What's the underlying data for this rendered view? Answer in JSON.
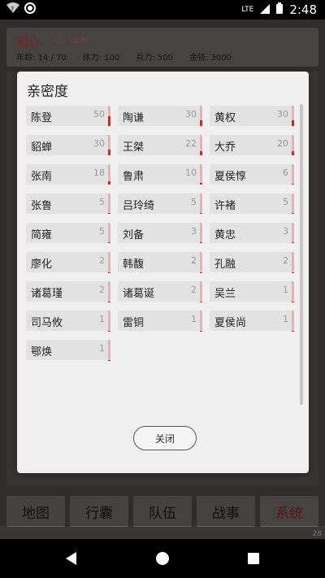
{
  "status_bar": {
    "time": "2:48",
    "network": "LTE"
  },
  "profile": {
    "name": "初心",
    "tags": "[无] [弈虎]",
    "age_label": "年龄: 14 / 70",
    "stamina_label": "体力: 100",
    "troops_label": "兵力: 500",
    "money_label": "金钱: 3000"
  },
  "dialog": {
    "title": "亲密度",
    "close_label": "关闭",
    "items": [
      {
        "name": "陈登",
        "value": 50
      },
      {
        "name": "陶谦",
        "value": 30
      },
      {
        "name": "黄权",
        "value": 30
      },
      {
        "name": "貂蝉",
        "value": 30
      },
      {
        "name": "王桀",
        "value": 22
      },
      {
        "name": "大乔",
        "value": 20
      },
      {
        "name": "张南",
        "value": 18
      },
      {
        "name": "鲁肃",
        "value": 10
      },
      {
        "name": "夏侯惇",
        "value": 6
      },
      {
        "name": "张鲁",
        "value": 5
      },
      {
        "name": "吕玲绮",
        "value": 5
      },
      {
        "name": "许褚",
        "value": 5
      },
      {
        "name": "简雍",
        "value": 5
      },
      {
        "name": "刘备",
        "value": 3
      },
      {
        "name": "黄忠",
        "value": 3
      },
      {
        "name": "廖化",
        "value": 2
      },
      {
        "name": "韩馥",
        "value": 2
      },
      {
        "name": "孔融",
        "value": 2
      },
      {
        "name": "诸葛瑾",
        "value": 2
      },
      {
        "name": "诸葛诞",
        "value": 2
      },
      {
        "name": "吴兰",
        "value": 1
      },
      {
        "name": "司马攸",
        "value": 1
      },
      {
        "name": "雷铜",
        "value": 1
      },
      {
        "name": "夏侯尚",
        "value": 1
      },
      {
        "name": "鄂焕",
        "value": 1
      }
    ]
  },
  "tabs": [
    {
      "label": "地图"
    },
    {
      "label": "行囊"
    },
    {
      "label": "队伍"
    },
    {
      "label": "战事"
    },
    {
      "label": "系统"
    }
  ],
  "page_number": "28",
  "colors": {
    "bar_fill": "#dd2222",
    "bar_track": "#e0b4b4",
    "accent_name": "#c03232"
  }
}
